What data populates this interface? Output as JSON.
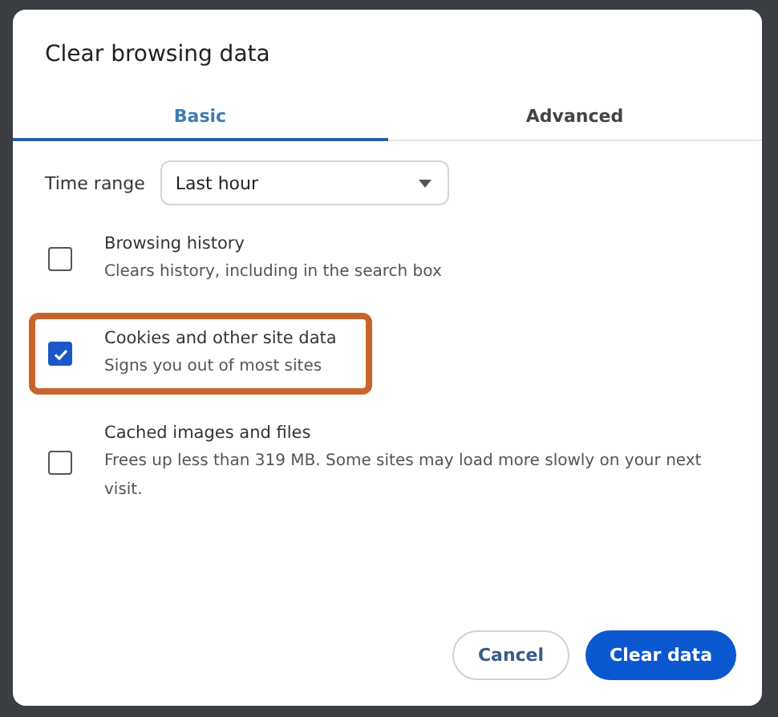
{
  "dialog": {
    "title": "Clear browsing data"
  },
  "tabs": [
    {
      "label": "Basic",
      "selected": true
    },
    {
      "label": "Advanced",
      "selected": false
    }
  ],
  "time_range": {
    "label": "Time range",
    "value": "Last hour"
  },
  "options": [
    {
      "title": "Browsing history",
      "description": "Clears history, including in the search box",
      "checked": false,
      "highlighted": false
    },
    {
      "title": "Cookies and other site data",
      "description": "Signs you out of most sites",
      "checked": true,
      "highlighted": true
    },
    {
      "title": "Cached images and files",
      "description": "Frees up less than 319 MB. Some sites may load more slowly on your next visit.",
      "checked": false,
      "highlighted": false
    }
  ],
  "buttons": {
    "cancel": "Cancel",
    "confirm": "Clear data"
  }
}
